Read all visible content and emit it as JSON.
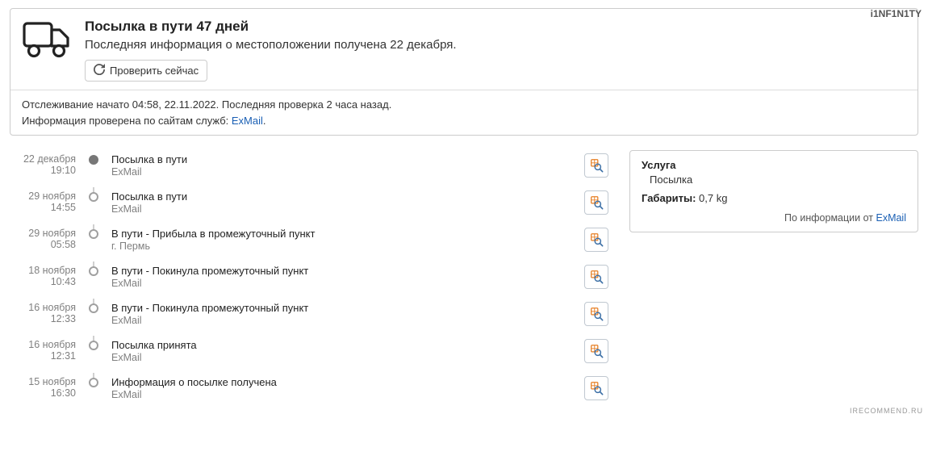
{
  "watermark_top": "i1NF1N1TY",
  "watermark_bottom": "IRECOMMEND.RU",
  "header": {
    "title": "Посылка в пути 47 дней",
    "subtitle": "Последняя информация о местоположении получена 22 декабря.",
    "refresh_label": "Проверить сейчас"
  },
  "info": {
    "line1": "Отслеживание начато 04:58, 22.11.2022. Последняя проверка 2 часа назад.",
    "line2_prefix": "Информация проверена по сайтам служб: ",
    "line2_link": "ExMail",
    "line2_suffix": "."
  },
  "events": [
    {
      "date": "22 декабря",
      "time": "19:10",
      "status": "Посылка в пути",
      "carrier": "ExMail"
    },
    {
      "date": "29 ноября",
      "time": "14:55",
      "status": "Посылка в пути",
      "carrier": "ExMail"
    },
    {
      "date": "29 ноября",
      "time": "05:58",
      "status": "В пути - Прибыла в промежуточный пункт",
      "carrier": "г. Пермь"
    },
    {
      "date": "18 ноября",
      "time": "10:43",
      "status": "В пути - Покинула промежуточный пункт",
      "carrier": "ExMail"
    },
    {
      "date": "16 ноября",
      "time": "12:33",
      "status": "В пути - Покинула промежуточный пункт",
      "carrier": "ExMail"
    },
    {
      "date": "16 ноября",
      "time": "12:31",
      "status": "Посылка принята",
      "carrier": "ExMail"
    },
    {
      "date": "15 ноября",
      "time": "16:30",
      "status": "Информация о посылке получена",
      "carrier": "ExMail"
    }
  ],
  "side": {
    "service_label": "Услуга",
    "service_value": "Посылка",
    "dimensions_label": "Габариты:",
    "dimensions_value": "0,7 kg",
    "footer_prefix": "По информации от ",
    "footer_link": "ExMail"
  }
}
